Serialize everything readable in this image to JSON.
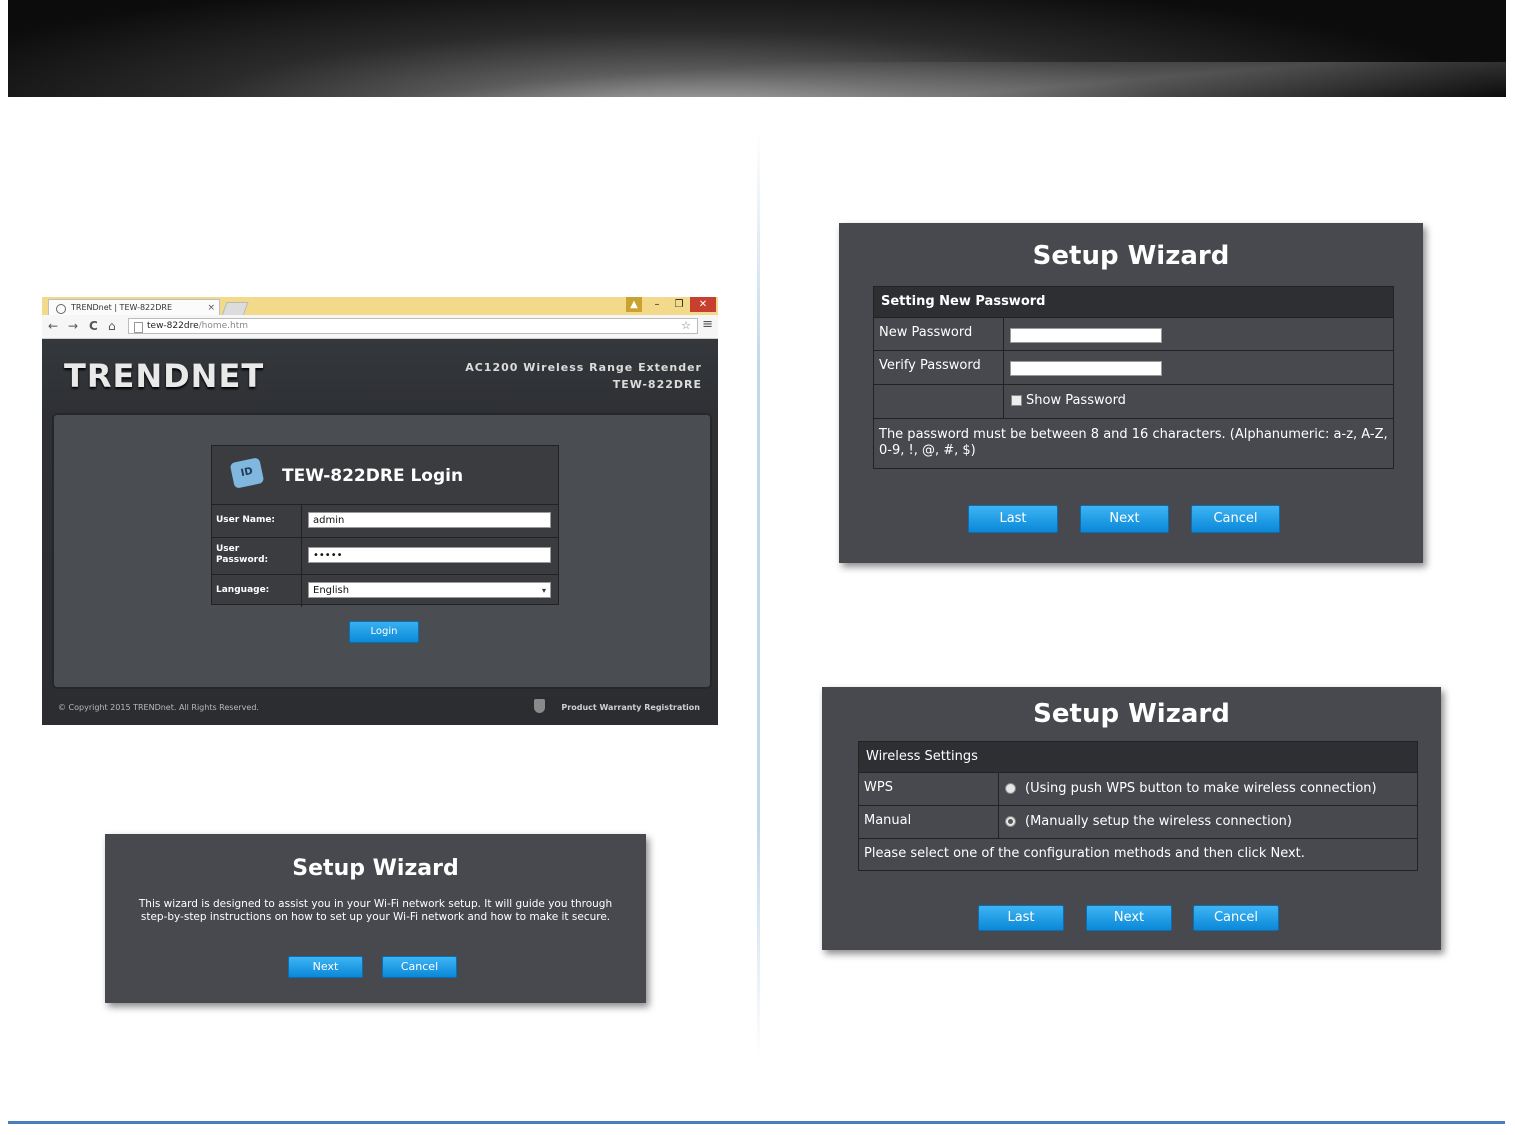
{
  "colors": {
    "banner": "#1a1a1a",
    "dialog_bg": "#47494f",
    "button_blue": "#1a98e6",
    "footer_line": "#4a7dbd"
  },
  "browser": {
    "tab_title": "TRENDnet | TEW-822DRE",
    "tab_close": "×",
    "window_controls": {
      "user": "▲",
      "minimize": "–",
      "maximize": "❐",
      "close": "✕"
    },
    "nav": {
      "back": "←",
      "forward": "→",
      "reload": "C",
      "home": "⌂",
      "star": "☆",
      "menu": "≡"
    },
    "url_host": "tew-822dre",
    "url_path": "/home.htm"
  },
  "router": {
    "brand": "TRENDNET",
    "model_line1": "AC1200 Wireless Range Extender",
    "model_line2": "TEW-822DRE",
    "login": {
      "icon_text": "ID",
      "title": "TEW-822DRE Login",
      "username_label": "User Name:",
      "username_value": "admin",
      "password_label_1": "User",
      "password_label_2": "Password:",
      "password_value": "•••••",
      "language_label": "Language:",
      "language_value": "English",
      "language_arrow": "▾",
      "button": "Login"
    },
    "copyright": "© Copyright 2015 TRENDnet. All Rights Reserved.",
    "warranty": "Product Warranty Registration"
  },
  "wizard_intro": {
    "title": "Setup Wizard",
    "line1": "This wizard is designed to assist you in your Wi-Fi network setup. It will guide you through",
    "line2": "step-by-step instructions on how to set up your Wi-Fi network and how to make it secure.",
    "next": "Next",
    "cancel": "Cancel"
  },
  "wizard_password": {
    "title": "Setup Wizard",
    "section": "Setting New Password",
    "new_password_label": "New Password",
    "verify_password_label": "Verify Password",
    "show_password_label": "Show Password",
    "note_line1": "The password must be between 8 and 16 characters. (Alphanumeric: a-z, A-Z,",
    "note_line2": "0-9, !, @, #, $)",
    "last": "Last",
    "next": "Next",
    "cancel": "Cancel"
  },
  "wizard_wireless": {
    "title": "Setup Wizard",
    "section": "Wireless Settings",
    "wps_label": "WPS",
    "wps_desc": "(Using push WPS button to make wireless connection)",
    "manual_label": "Manual",
    "manual_desc": "(Manually setup the wireless connection)",
    "note": "Please select one of the configuration methods and then click Next.",
    "last": "Last",
    "next": "Next",
    "cancel": "Cancel"
  }
}
